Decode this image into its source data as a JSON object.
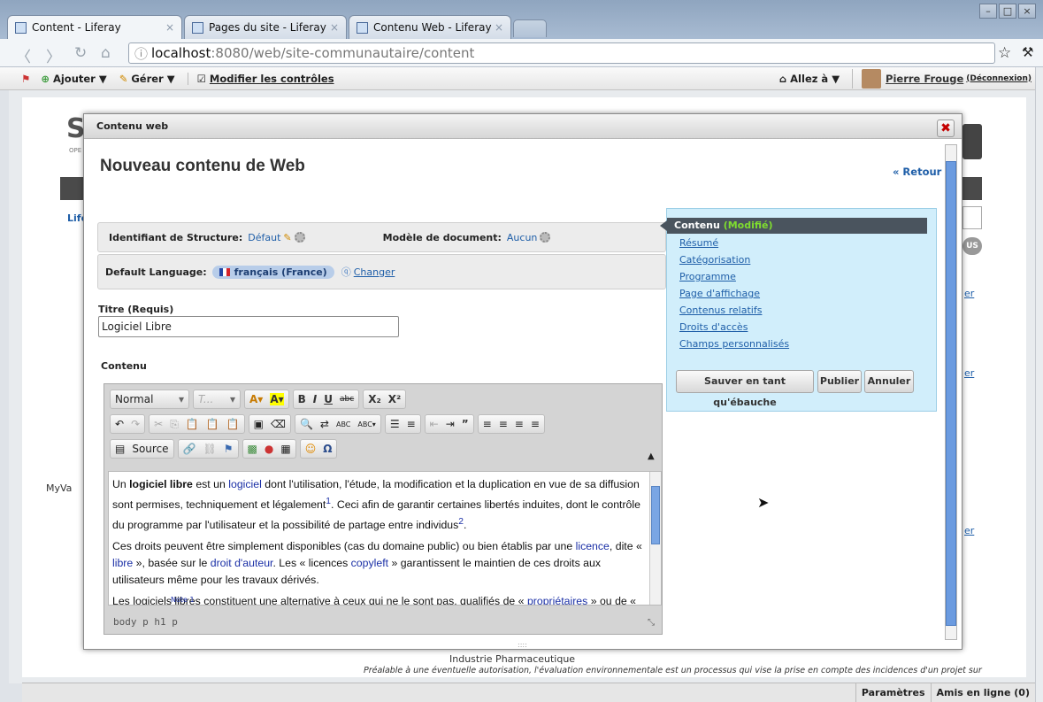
{
  "browser": {
    "tabs": [
      {
        "label": "Content - Liferay",
        "close": "×"
      },
      {
        "label": "Pages du site - Liferay",
        "close": "×"
      },
      {
        "label": "Contenu Web - Liferay",
        "close": "×"
      }
    ],
    "url_host": "localhost",
    "url_path": ":8080/web/site-communautaire/content",
    "window_buttons": [
      "–",
      "□",
      "×"
    ]
  },
  "dockbar": {
    "add": "Ajouter ▼",
    "manage": "Gérer ▼",
    "edit_controls": "Modifier les contrôles",
    "go_to": "Allez à ▼",
    "user_name": "Pierre Frouge",
    "logout": "(Déconnexion)"
  },
  "background": {
    "left_labels": [
      "S",
      "OPE",
      "Life",
      "MyVa"
    ],
    "right_labels": [
      "er",
      "er",
      "er",
      "US"
    ],
    "caption": "Industrie Pharmaceutique",
    "footnote": "Préalable à une éventuelle autorisation, l'évaluation environnementale est un processus qui vise la prise en compte des incidences d'un projet sur",
    "statusbar": [
      "Paramètres",
      "Amis en ligne (0)"
    ]
  },
  "dialog": {
    "header": "Contenu web",
    "close": "✖",
    "title": "Nouveau contenu de Web",
    "back": "« Retour",
    "structure_label": "Identifiant de Structure:",
    "structure_value": "Défaut",
    "template_label": "Modèle de document:",
    "template_value": "Aucun",
    "lang_label": "Default Language:",
    "lang_value": "français (France)",
    "lang_change": "Changer",
    "title_label": "Titre (Requis)",
    "title_value": "Logiciel Libre",
    "content_label": "Contenu",
    "editor": {
      "format": "Normal",
      "font": "T...",
      "bold": "B",
      "italic": "I",
      "underline": "U",
      "strike": "abc",
      "sub": "X₂",
      "sup": "X²",
      "source": "Source",
      "p1_a": "Un ",
      "p1_b": "logiciel libre",
      "p1_c": " est un ",
      "p1_link": "logiciel",
      "p1_d": " dont l'utilisation, l'étude, la modification et la duplication en vue de sa diffusion sont permises, techniquement et légalement",
      "p1_n1": "1",
      "p1_e": ". Ceci afin de garantir certaines libertés induites, dont le contrôle du programme par l'utilisateur et la possibilité de partage entre individus",
      "p1_n2": "2",
      "p1_f": ".",
      "p2_a": "Ces droits peuvent être simplement disponibles (cas du domaine public) ou bien établis par une ",
      "p2_l1": "licence",
      "p2_b": ", dite « ",
      "p2_l2": "libre",
      "p2_c": " », basée sur le ",
      "p2_l3": "droit d'auteur",
      "p2_d": ". Les « licences ",
      "p2_l4": "copyleft",
      "p2_e": " » garantissent le maintien de ces droits aux utilisateurs même pour les travaux dérivés.",
      "p3_a": "Les logiciels libres constituent une alternative à ceux qui ne le sont pas, qualifiés de « ",
      "p3_l": "propriétaires",
      "p3_b": " » ou de «",
      "note": "Note 1",
      "path": "body p h1 p"
    },
    "side": {
      "current": "Contenu",
      "modified": "(Modifié)",
      "links": [
        "Résumé",
        "Catégorisation",
        "Programme",
        "Page d'affichage",
        "Contenus relatifs",
        "Droits d'accès",
        "Champs personnalisés"
      ],
      "save_draft": "Sauver en tant qu'ébauche",
      "publish": "Publier",
      "cancel": "Annuler"
    }
  },
  "colors": {
    "accent_link": "#1e5ea8",
    "modified": "#7fdd2f",
    "side_bg": "#d1eefb"
  }
}
